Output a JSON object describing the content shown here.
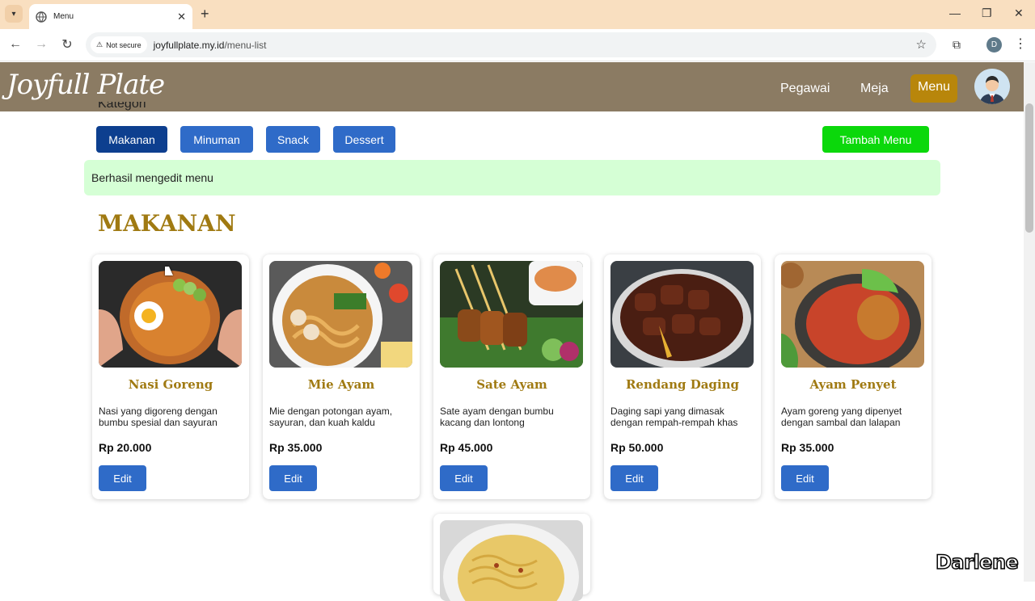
{
  "browser": {
    "tab_title": "Menu",
    "not_secure_label": "Not secure",
    "url_domain": "joyfullplate.my.id",
    "url_path": "/menu-list",
    "profile_initial": "D"
  },
  "header": {
    "logo": "Joyfull Plate",
    "nav": [
      "Pegawai",
      "Meja",
      "Menu"
    ],
    "active_nav": "Menu"
  },
  "kategori": {
    "heading": "Kategori",
    "buttons": [
      "Makanan",
      "Minuman",
      "Snack",
      "Dessert"
    ],
    "active": "Makanan"
  },
  "add_button": "Tambah Menu",
  "alert": "Berhasil mengedit menu",
  "section_title": "MAKANAN",
  "cards": [
    {
      "name": "Nasi Goreng",
      "desc": "Nasi yang digoreng dengan bumbu spesial dan sayuran",
      "price": "Rp 20.000",
      "edit": "Edit"
    },
    {
      "name": "Mie Ayam",
      "desc": "Mie dengan potongan ayam, sayuran, dan kuah kaldu",
      "price": "Rp 35.000",
      "edit": "Edit"
    },
    {
      "name": "Sate Ayam",
      "desc": "Sate ayam dengan bumbu kacang dan lontong",
      "price": "Rp 45.000",
      "edit": "Edit"
    },
    {
      "name": "Rendang Daging",
      "desc": "Daging sapi yang dimasak dengan rempah-rempah khas",
      "price": "Rp 50.000",
      "edit": "Edit"
    },
    {
      "name": "Ayam Penyet",
      "desc": "Ayam goreng yang dipenyet dengan sambal dan lalapan",
      "price": "Rp 35.000",
      "edit": "Edit"
    }
  ],
  "watermark": "Darlene",
  "colors": {
    "header_bg": "#8b7b63",
    "accent_gold": "#a07a12",
    "active_nav": "#b8860b",
    "button_blue": "#2f6bc8",
    "button_active": "#0d3f8f",
    "add_green": "#0bd80b",
    "alert_bg": "#d5ffd5"
  }
}
